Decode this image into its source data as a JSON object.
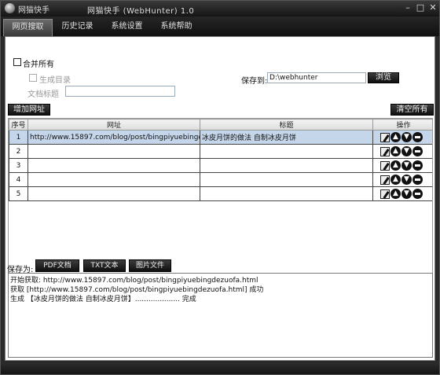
{
  "titlebar": {
    "app_name": "网猫快手",
    "window_title": "网猫快手 (WebHunter) 1.0",
    "min": "–",
    "max": "□",
    "close": "✕"
  },
  "tabs": [
    {
      "label": "网页搜取",
      "active": true
    },
    {
      "label": "历史记录",
      "active": false
    },
    {
      "label": "系统设置",
      "active": false
    },
    {
      "label": "系统帮助",
      "active": false
    }
  ],
  "options": {
    "merge_all": "合并所有",
    "gen_toc": "生成目录",
    "doc_title_label": "文档标题",
    "doc_title_value": "",
    "save_to_label": "保存到:",
    "save_path": "D:\\webhunter",
    "browse": "浏览"
  },
  "actions": {
    "add_url": "增加网址",
    "clear_all": "清空所有"
  },
  "table": {
    "columns": [
      "序号",
      "网址",
      "标题",
      "操作"
    ],
    "rows": [
      {
        "no": "1",
        "url": "http://www.15897.com/blog/post/bingpiyuebingdezuofa...",
        "title": "冰皮月饼的做法 自制冰皮月饼",
        "selected": true
      },
      {
        "no": "2",
        "url": "",
        "title": "",
        "selected": false
      },
      {
        "no": "3",
        "url": "",
        "title": "",
        "selected": false
      },
      {
        "no": "4",
        "url": "",
        "title": "",
        "selected": false
      },
      {
        "no": "5",
        "url": "",
        "title": "",
        "selected": false
      }
    ]
  },
  "save_as": {
    "label": "保存为:",
    "pdf": "PDF文档",
    "txt": "TXT文本",
    "img": "图片文件"
  },
  "log": [
    "开始获取: http://www.15897.com/blog/post/bingpiyuebingdezuofa.html",
    "获取 [http://www.15897.com/blog/post/bingpiyuebingdezuofa.html] 成功",
    "生成 【冰皮月饼的做法 自制冰皮月饼】.................... 完成"
  ]
}
